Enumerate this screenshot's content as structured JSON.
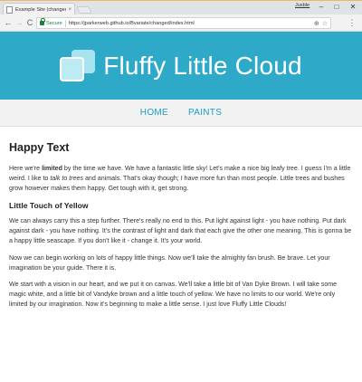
{
  "browser": {
    "tab_title": "Example Site (changed)",
    "tab_close": "×",
    "user": "Jusble",
    "window_buttons": {
      "minimize": "–",
      "maximize": "□",
      "close": "✕"
    },
    "nav": {
      "back": "←",
      "forward": "→",
      "reload": "C"
    },
    "security_label": "Secure",
    "url": "https://jparkerweb.github.io/Bvariate/changed/index.html",
    "omnibox_icons": {
      "extension": "⊕",
      "bookmark": "☆"
    },
    "menu": "⋮"
  },
  "header": {
    "title": "Fluffy Little Cloud",
    "colors": {
      "background": "#2eaac8",
      "text": "#ffffff"
    }
  },
  "nav": {
    "items": [
      {
        "label": "HOME"
      },
      {
        "label": "PAINTS"
      }
    ],
    "link_color": "#1a9ec0"
  },
  "content": {
    "heading": "Happy Text",
    "p1": {
      "a": "Here we're ",
      "b": "limited",
      "c": " by the time we have. We have a fantastic little sky! Let's make a nice big leafy tree. I guess I'm a little weird. I like to ",
      "d": "talk to trees",
      "e": " and animals. That's okay though; I have more fun than most people. Little trees and bushes grow however makes them happy. Get tough with it, get strong."
    },
    "subheading": "Little Touch of Yellow",
    "p2": "We can always carry this a step further. There's really no end to this. Put light against light - you have nothing. Put dark against dark - you have nothing. It's the contrast of light and dark that each give the other one meaning. This is gonna be a happy little seascape. If you don't like it - change it. It's your world.",
    "p3": "Now we can begin working on lots of happy little things. Now we'll take the almighty fan brush. Be brave. Let your imagination be your guide. There it is.",
    "p4": "We start with a vision in our heart, and we put it on canvas. We'll take a little bit of Van Dyke Brown. I will take some magic white, and a little bit of Vandyke brown and a little touch of yellow. We have no limits to our world. We're only limited by our imagination. Now it's beginning to make a little sense. I just love Fluffy Little Clouds!"
  }
}
